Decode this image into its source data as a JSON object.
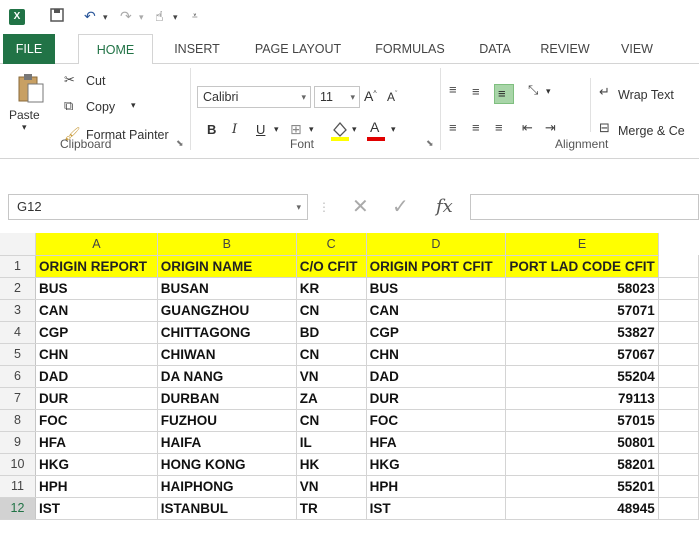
{
  "app": {
    "logo": "X",
    "quick_access": [
      "save-icon",
      "undo-icon",
      "redo-icon",
      "touch-mode-icon",
      "customize-icon"
    ]
  },
  "tabs": [
    "FILE",
    "HOME",
    "INSERT",
    "PAGE LAYOUT",
    "FORMULAS",
    "DATA",
    "REVIEW",
    "VIEW"
  ],
  "active_tab": "HOME",
  "ribbon": {
    "clipboard": {
      "paste": "Paste",
      "cut": "Cut",
      "copy": "Copy",
      "format_painter": "Format Painter",
      "label": "Clipboard"
    },
    "font": {
      "family": "Calibri",
      "size": "11",
      "bold": "B",
      "italic": "I",
      "underline": "U",
      "font_color_letter": "A",
      "label": "Font"
    },
    "alignment": {
      "wrap_text": "Wrap Text",
      "merge_center": "Merge & Ce",
      "label": "Alignment"
    }
  },
  "formula_bar": {
    "name_box": "G12",
    "fx": "fx",
    "value": ""
  },
  "sheet": {
    "columns": [
      "A",
      "B",
      "C",
      "D",
      "E"
    ],
    "rows": [
      {
        "n": "1",
        "cells": [
          "ORIGIN REPORT",
          "ORIGIN NAME",
          "C/O CFIT",
          "ORIGIN PORT CFIT",
          "PORT LAD CODE CFIT"
        ]
      },
      {
        "n": "2",
        "cells": [
          "BUS",
          "BUSAN",
          "KR",
          "BUS",
          "58023"
        ]
      },
      {
        "n": "3",
        "cells": [
          "CAN",
          "GUANGZHOU",
          "CN",
          "CAN",
          "57071"
        ]
      },
      {
        "n": "4",
        "cells": [
          "CGP",
          "CHITTAGONG",
          "BD",
          "CGP",
          "53827"
        ]
      },
      {
        "n": "5",
        "cells": [
          "CHN",
          "CHIWAN",
          "CN",
          "CHN",
          "57067"
        ]
      },
      {
        "n": "6",
        "cells": [
          "DAD",
          "DA NANG",
          "VN",
          "DAD",
          "55204"
        ]
      },
      {
        "n": "7",
        "cells": [
          "DUR",
          "DURBAN",
          "ZA",
          "DUR",
          "79113"
        ]
      },
      {
        "n": "8",
        "cells": [
          "FOC",
          "FUZHOU",
          "CN",
          "FOC",
          "57015"
        ]
      },
      {
        "n": "9",
        "cells": [
          "HFA",
          "HAIFA",
          "IL",
          "HFA",
          "50801"
        ]
      },
      {
        "n": "10",
        "cells": [
          "HKG",
          "HONG KONG",
          "HK",
          "HKG",
          "58201"
        ]
      },
      {
        "n": "11",
        "cells": [
          "HPH",
          "HAIPHONG",
          "VN",
          "HPH",
          "55201"
        ]
      },
      {
        "n": "12",
        "cells": [
          "IST",
          "ISTANBUL",
          "TR",
          "IST",
          "48945"
        ]
      }
    ],
    "selected_row": "12"
  },
  "colors": {
    "brand": "#217346",
    "header_highlight": "#ffff00"
  }
}
